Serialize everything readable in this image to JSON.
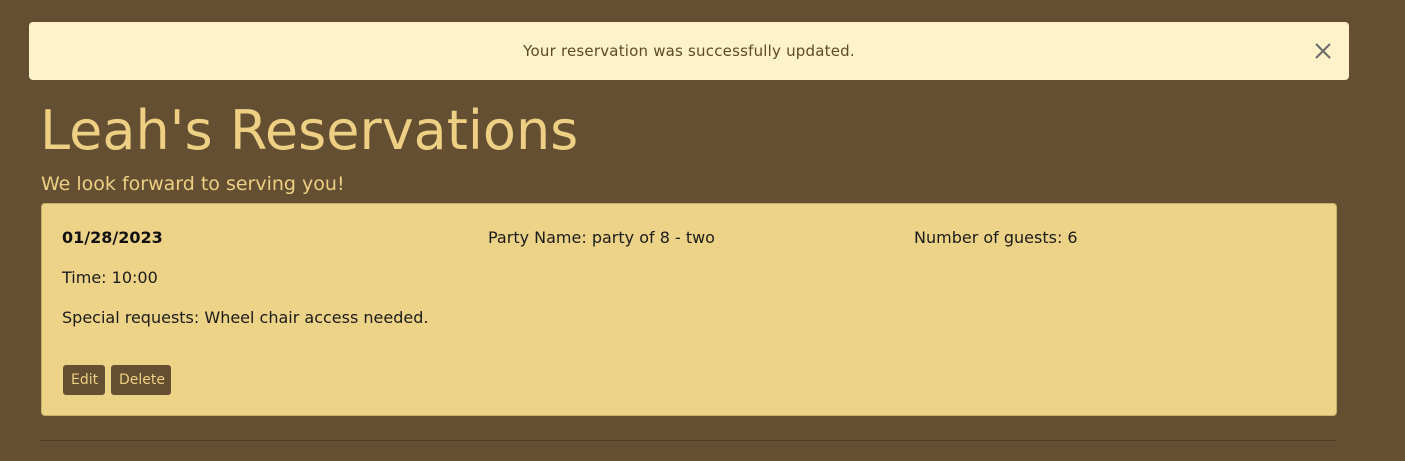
{
  "alert": {
    "message": "Your reservation was successfully updated.",
    "close_icon": "close-icon"
  },
  "page": {
    "title": "Leah's Reservations",
    "subtitle": "We look forward to serving you!"
  },
  "reservation": {
    "date": "01/28/2023",
    "party_name": "Party Name: party of 8 - two",
    "guests": "Number of guests: 6",
    "time": "Time: 10:00",
    "special_requests": "Special requests: Wheel chair access needed.",
    "edit_label": "Edit",
    "delete_label": "Delete"
  },
  "colors": {
    "background": "#654F32",
    "alert_bg": "#FFF2C9",
    "accent_text": "#EDD083",
    "card_bg": "#EDD387",
    "button_bg": "#654F32"
  }
}
